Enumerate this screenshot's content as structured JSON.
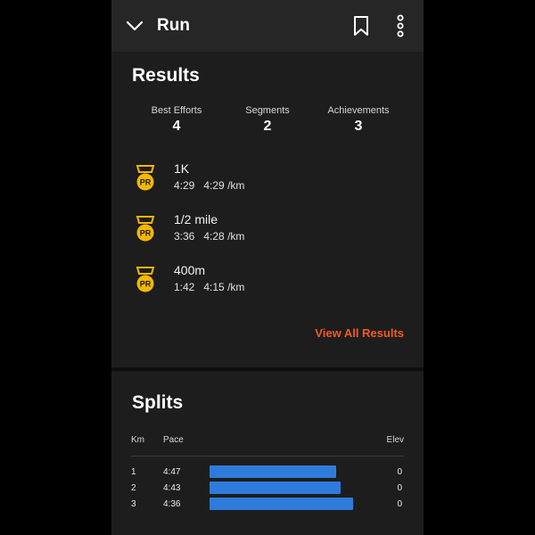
{
  "header": {
    "title": "Run"
  },
  "results": {
    "heading": "Results",
    "stats": [
      {
        "label": "Best Efforts",
        "value": "4"
      },
      {
        "label": "Segments",
        "value": "2"
      },
      {
        "label": "Achievements",
        "value": "3"
      }
    ],
    "efforts": [
      {
        "badge": "PR",
        "name": "1K",
        "time": "4:29",
        "pace": "4:29 /km"
      },
      {
        "badge": "PR",
        "name": "1/2 mile",
        "time": "3:36",
        "pace": "4:28 /km"
      },
      {
        "badge": "PR",
        "name": "400m",
        "time": "1:42",
        "pace": "4:15 /km"
      }
    ],
    "view_all": "View All Results"
  },
  "splits": {
    "heading": "Splits",
    "columns": {
      "km": "Km",
      "pace": "Pace",
      "elev": "Elev"
    },
    "rows": [
      {
        "km": "1",
        "pace": "4:47",
        "pace_fraction": 0.88,
        "elev": "0"
      },
      {
        "km": "2",
        "pace": "4:43",
        "pace_fraction": 0.91,
        "elev": "0"
      },
      {
        "km": "3",
        "pace": "4:36",
        "pace_fraction": 1.0,
        "elev": "0"
      }
    ]
  },
  "colors": {
    "accent": "#f05a22",
    "bar": "#2f7bdb",
    "medal": "#f5b700"
  }
}
